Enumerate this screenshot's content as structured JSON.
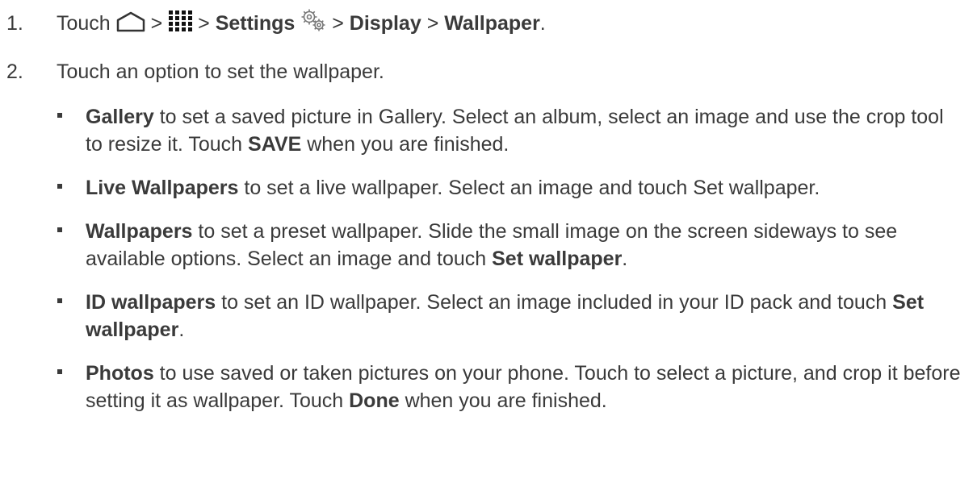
{
  "step1": {
    "number": "1.",
    "touch": "Touch",
    "sep": ">",
    "home_icon": "home-icon",
    "apps_icon": "apps-grid-icon",
    "settings_label": "Settings",
    "settings_icon": "gear-icon",
    "display_label": "Display",
    "wallpaper_label": "Wallpaper",
    "period": "."
  },
  "step2": {
    "number": "2.",
    "text": "Touch an option to set the wallpaper."
  },
  "options": [
    {
      "title": "Gallery",
      "text_a": " to set a saved picture in Gallery. Select an album, select an image and use the crop tool to resize it. Touch ",
      "bold_b": "SAVE",
      "text_b": " when you are finished."
    },
    {
      "title": "Live Wallpapers",
      "text_a": " to set a live wallpaper. Select an image and touch Set wallpaper.",
      "bold_b": "",
      "text_b": ""
    },
    {
      "title": "Wallpapers",
      "text_a": " to set a preset wallpaper. Slide the small image on the screen sideways to see available options. Select an image and touch ",
      "bold_b": "Set wallpaper",
      "text_b": "."
    },
    {
      "title": "ID wallpapers",
      "text_a": " to set an ID wallpaper. Select an image included in your ID pack and touch ",
      "bold_b": "Set wallpaper",
      "text_b": "."
    },
    {
      "title": "Photos",
      "text_a": " to use saved or taken pictures on your phone. Touch to select a picture, and crop it before setting it as wallpaper. Touch ",
      "bold_b": "Done",
      "text_b": " when you are finished."
    }
  ]
}
